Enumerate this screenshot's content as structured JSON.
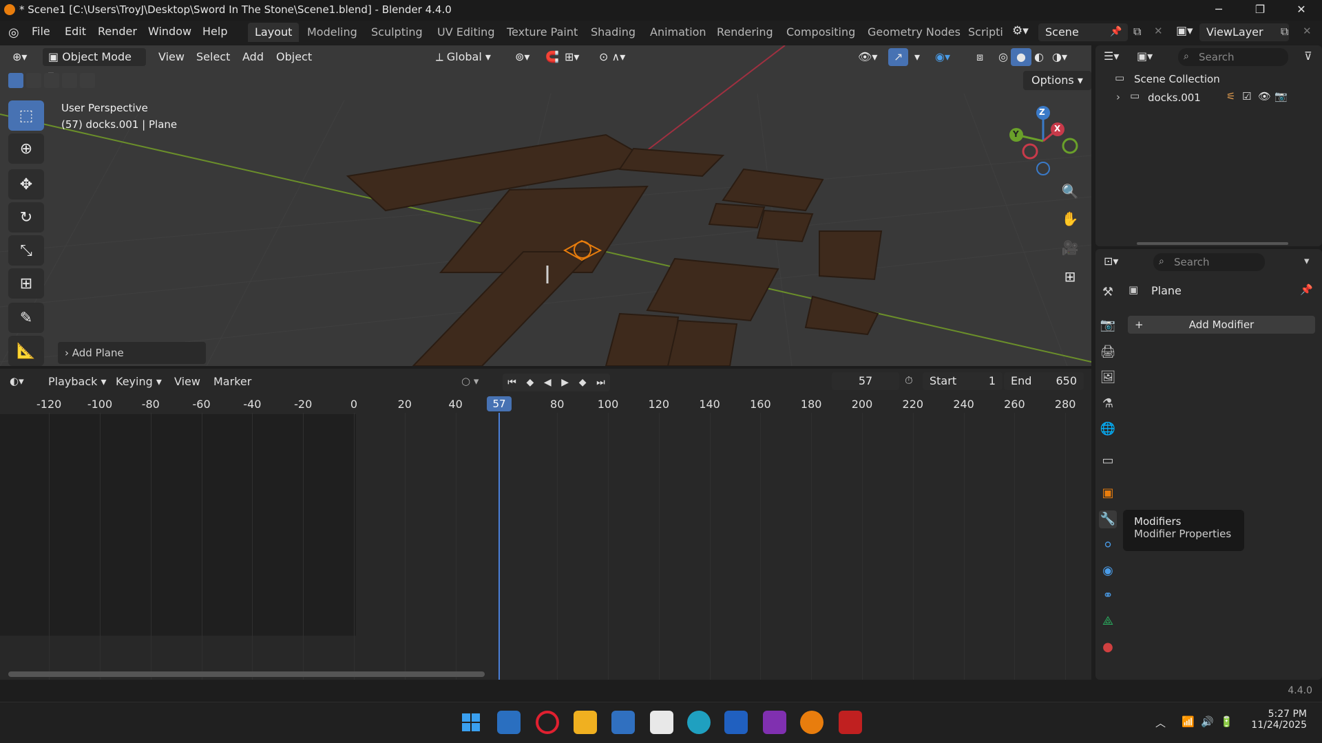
{
  "titlebar": {
    "title": "* Scene1 [C:\\Users\\TroyJ\\Desktop\\Sword In The Stone\\Scene1.blend] - Blender 4.4.0",
    "min": "─",
    "max": "❐",
    "close": "✕"
  },
  "menubar": {
    "menus": [
      "File",
      "Edit",
      "Render",
      "Window",
      "Help"
    ],
    "workspaces": [
      "Layout",
      "Modeling",
      "Sculpting",
      "UV Editing",
      "Texture Paint",
      "Shading",
      "Animation",
      "Rendering",
      "Compositing",
      "Geometry Nodes",
      "Scripti"
    ],
    "scene": "Scene",
    "view_layer": "ViewLayer"
  },
  "viewport": {
    "mode": "Object Mode",
    "menus": [
      "View",
      "Select",
      "Add",
      "Object"
    ],
    "transform_orientation": "Global",
    "options": "Options",
    "perspective": "User Perspective",
    "object_info": "(57) docks.001 | Plane",
    "last_op": "Add Plane",
    "gizmo": {
      "x": "X",
      "y": "Y",
      "z": "Z"
    }
  },
  "outliner": {
    "search_placeholder": "Search",
    "collection": "Scene Collection",
    "items": [
      {
        "name": "docks.001"
      }
    ]
  },
  "properties": {
    "search_placeholder": "Search",
    "object_name": "Plane",
    "add_modifier": "Add Modifier",
    "tooltip_title": "Modifiers",
    "tooltip_sub": "Modifier Properties"
  },
  "timeline": {
    "menus": [
      "Playback",
      "Keying",
      "View",
      "Marker"
    ],
    "current_frame": "57",
    "start_label": "Start",
    "start": "1",
    "end_label": "End",
    "end": "650",
    "ticks": [
      "-120",
      "-100",
      "-80",
      "-60",
      "-40",
      "-20",
      "0",
      "20",
      "40",
      "80",
      "100",
      "120",
      "140",
      "160",
      "180",
      "200",
      "220",
      "240",
      "260",
      "280"
    ],
    "playhead": "57"
  },
  "statusbar": {
    "version": "4.4.0"
  },
  "taskbar": {
    "time": "5:27 PM",
    "date": "11/24/2025"
  },
  "colors": {
    "accent": "#4772b3",
    "selection": "#e87d0d",
    "dock": "#3e2a1c"
  }
}
